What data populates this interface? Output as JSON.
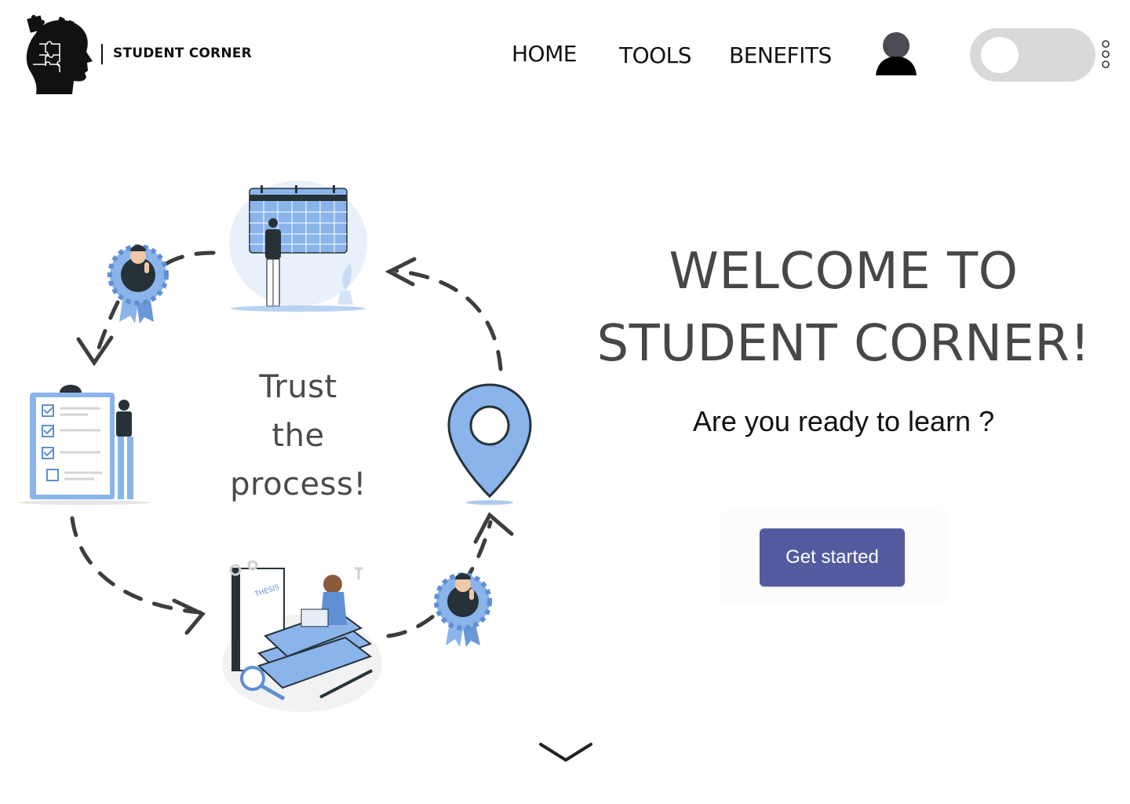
{
  "brand": {
    "name": "STUDENT CORNER",
    "logo_icon": "puzzle-head-icon"
  },
  "nav": {
    "items": [
      {
        "label": "HOME"
      },
      {
        "label": "TOOLS"
      },
      {
        "label": "BENEFITS"
      }
    ],
    "profile_icon": "user-icon",
    "theme_toggle": {
      "state": "off"
    },
    "more_icon": "kebab-menu-icon"
  },
  "illustration": {
    "caption_lines": [
      "Trust",
      "the",
      "process!"
    ],
    "steps": [
      "calendar-planning",
      "location-pin",
      "studying-books",
      "checklist",
      "award-badge"
    ]
  },
  "hero": {
    "title_line1": "WELCOME TO",
    "title_line2": "STUDENT CORNER!",
    "subtitle": "Are you ready to learn ?",
    "cta_label": "Get started"
  },
  "scroll_icon": "chevron-down-icon",
  "colors": {
    "accent": "#535b9e",
    "illustration_blue": "#8ab4ea",
    "heading": "#474747",
    "toggle_track": "#d9d9d9"
  }
}
